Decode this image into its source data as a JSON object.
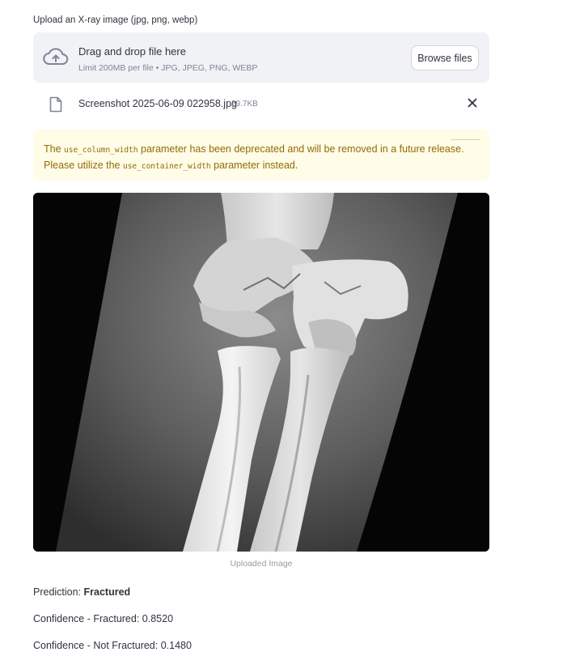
{
  "uploader": {
    "label": "Upload an X-ray image (jpg, png, webp)",
    "drop_title": "Drag and drop file here",
    "limit_text": "Limit 200MB per file • JPG, JPEG, PNG, WEBP",
    "browse_label": "Browse files",
    "icon": "cloud-upload-icon"
  },
  "uploaded_file": {
    "name": "Screenshot 2025-06-09 022958.jpg",
    "size": "29.7KB",
    "icon": "file-icon",
    "remove_icon": "close-icon"
  },
  "warning": {
    "text_1": "The ",
    "code_1": "use_column_width",
    "text_2": " parameter has been deprecated and will be removed in a future release. Please utilize the ",
    "code_2": "use_container_width",
    "text_3": " parameter instead.",
    "color": "#926c05",
    "background": "#fffce7"
  },
  "image": {
    "caption": "Uploaded Image"
  },
  "results": {
    "prediction_label": "Prediction: ",
    "prediction_value": "Fractured",
    "confidence_fractured": "Confidence - Fractured: 0.8520",
    "confidence_not_fractured": "Confidence - Not Fractured: 0.1480"
  }
}
